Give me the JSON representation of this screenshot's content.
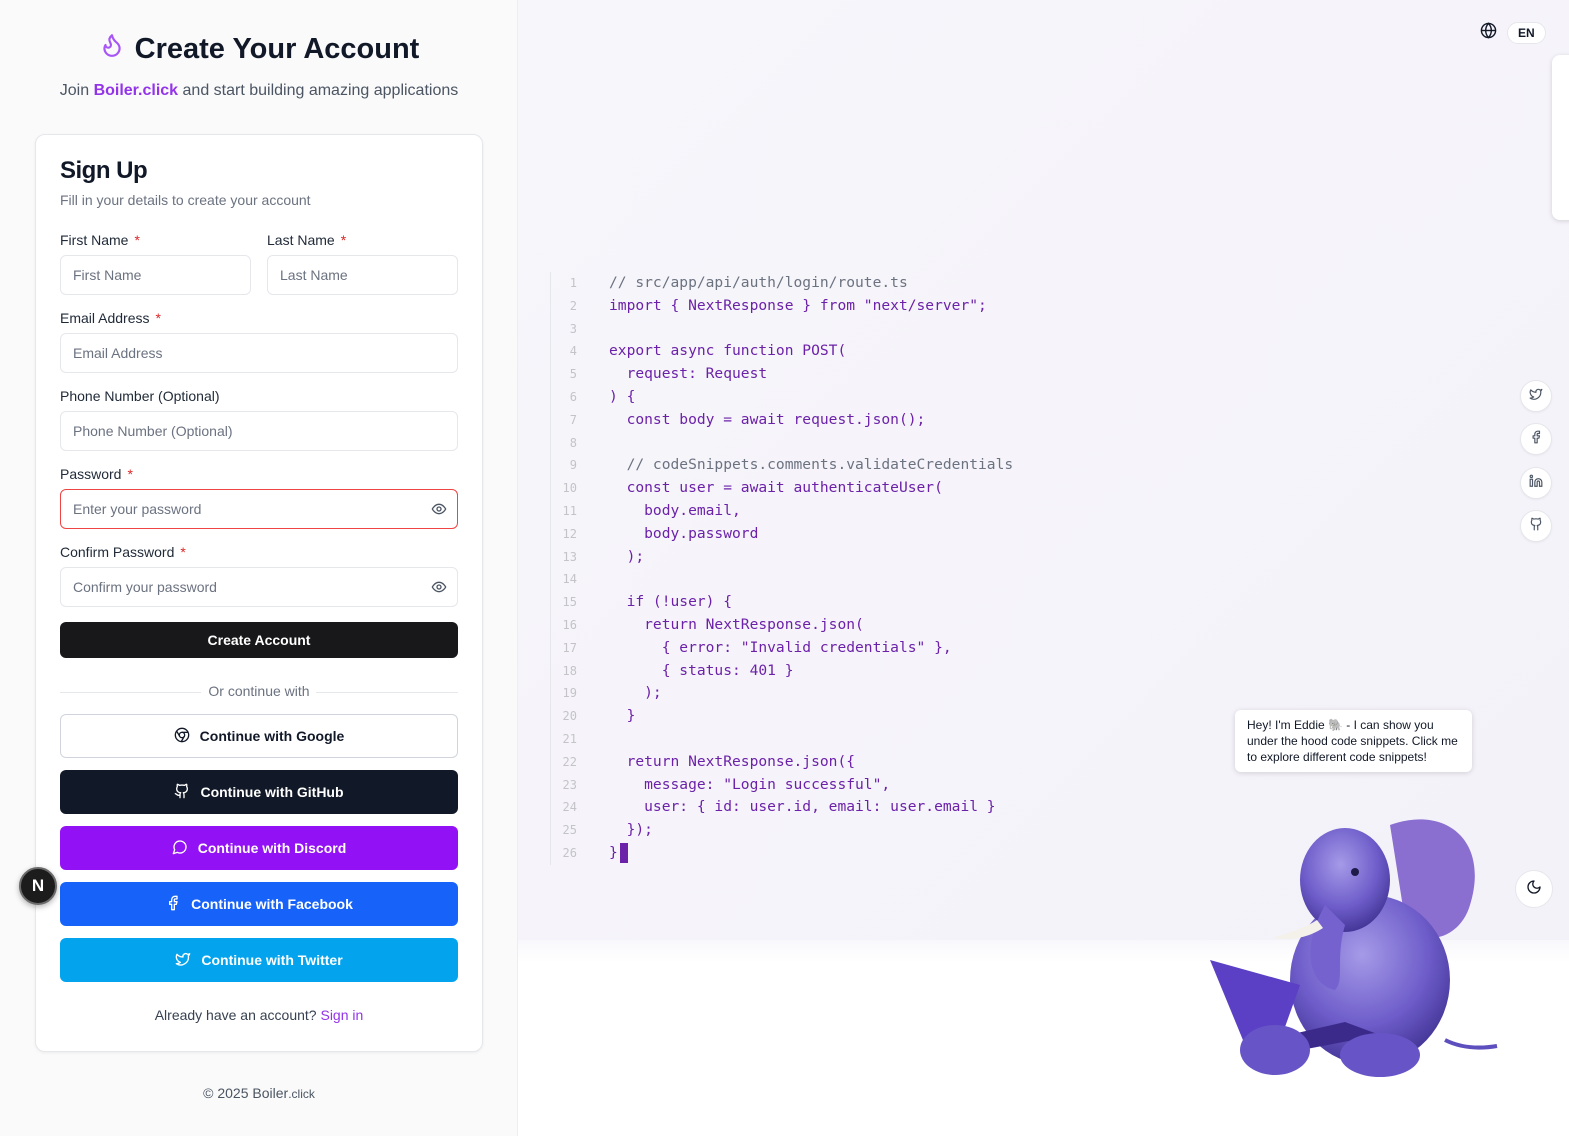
{
  "hero": {
    "title": "Create Your Account",
    "subtitle_prefix": "Join",
    "brand": "Boiler.click",
    "subtitle_suffix": "and start building amazing applications"
  },
  "form": {
    "title": "Sign Up",
    "description": "Fill in your details to create your account",
    "required_mark": "*",
    "first_name": {
      "label": "First Name",
      "placeholder": "First Name",
      "value": ""
    },
    "last_name": {
      "label": "Last Name",
      "placeholder": "Last Name",
      "value": ""
    },
    "email": {
      "label": "Email Address",
      "placeholder": "Email Address",
      "value": ""
    },
    "phone": {
      "label": "Phone Number (Optional)",
      "placeholder": "Phone Number (Optional)",
      "value": ""
    },
    "password": {
      "label": "Password",
      "placeholder": "Enter your password",
      "value": ""
    },
    "confirm_password": {
      "label": "Confirm Password",
      "placeholder": "Confirm your password",
      "value": ""
    },
    "submit_label": "Create Account",
    "divider_text": "Or continue with",
    "oauth": {
      "google": "Continue with Google",
      "github": "Continue with GitHub",
      "discord": "Continue with Discord",
      "facebook": "Continue with Facebook",
      "twitter": "Continue with Twitter"
    },
    "signin_prompt": "Already have an account?",
    "signin_link": "Sign in"
  },
  "footer": {
    "copyright": "© 2025 Boiler",
    "suffix": ".click"
  },
  "dev_badge": "N",
  "language": {
    "current": "EN"
  },
  "code": {
    "lines": [
      {
        "n": "1",
        "text": "// src/app/api/auth/login/route.ts",
        "comment": true
      },
      {
        "n": "2",
        "text": "import { NextResponse } from \"next/server\";"
      },
      {
        "n": "3",
        "text": ""
      },
      {
        "n": "4",
        "text": "export async function POST("
      },
      {
        "n": "5",
        "text": "  request: Request"
      },
      {
        "n": "6",
        "text": ") {"
      },
      {
        "n": "7",
        "text": "  const body = await request.json();"
      },
      {
        "n": "8",
        "text": ""
      },
      {
        "n": "9",
        "text": "  // codeSnippets.comments.validateCredentials",
        "comment": true
      },
      {
        "n": "10",
        "text": "  const user = await authenticateUser("
      },
      {
        "n": "11",
        "text": "    body.email,"
      },
      {
        "n": "12",
        "text": "    body.password"
      },
      {
        "n": "13",
        "text": "  );"
      },
      {
        "n": "14",
        "text": ""
      },
      {
        "n": "15",
        "text": "  if (!user) {"
      },
      {
        "n": "16",
        "text": "    return NextResponse.json("
      },
      {
        "n": "17",
        "text": "      { error: \"Invalid credentials\" },"
      },
      {
        "n": "18",
        "text": "      { status: 401 }"
      },
      {
        "n": "19",
        "text": "    );"
      },
      {
        "n": "20",
        "text": "  }"
      },
      {
        "n": "21",
        "text": ""
      },
      {
        "n": "22",
        "text": "  return NextResponse.json({"
      },
      {
        "n": "23",
        "text": "    message: \"Login successful\","
      },
      {
        "n": "24",
        "text": "    user: { id: user.id, email: user.email }"
      },
      {
        "n": "25",
        "text": "  });"
      },
      {
        "n": "26",
        "text": "}",
        "cursor": true
      }
    ]
  },
  "social_icons": [
    "twitter-icon",
    "facebook-icon",
    "linkedin-icon",
    "github-icon"
  ],
  "theme_icon": "moon-icon",
  "mascot": {
    "bubble": "Hey! I'm Eddie 🐘 - I can show you under the hood code snippets. Click me to explore different code snippets!"
  },
  "colors": {
    "accent": "#9333ea",
    "primary_button": "#18181b",
    "github": "#111827",
    "discord": "#9311f5",
    "facebook": "#1763fa",
    "twitter": "#03a4ed",
    "error_border": "#ef4444",
    "code_text": "#6b21a8"
  }
}
